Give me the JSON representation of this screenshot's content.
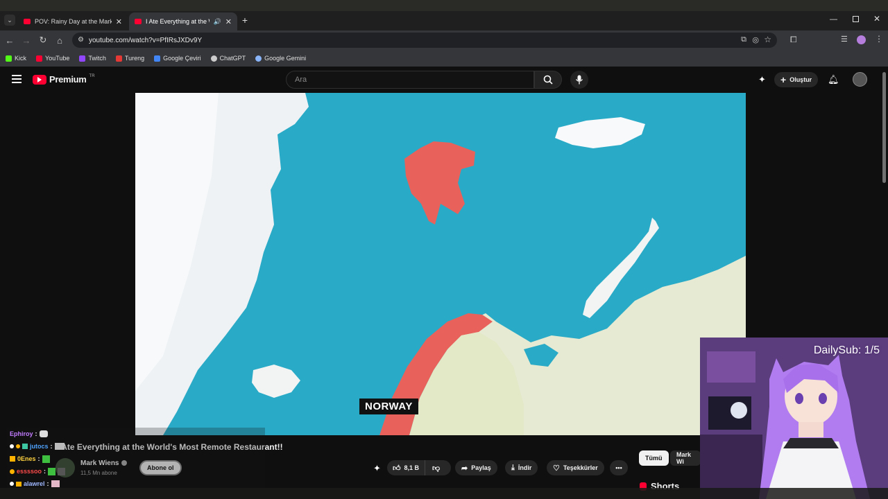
{
  "browser": {
    "tabs": [
      {
        "title": "POV: Rainy Day at the Market -",
        "active": false
      },
      {
        "title": "I Ate Everything at the Worl",
        "active": true
      }
    ],
    "url": "youtube.com/watch?v=PfIRsJXDv9Y",
    "bookmarks": [
      {
        "label": "Kick",
        "color": "#53fc18"
      },
      {
        "label": "YouTube",
        "color": "#ff0033"
      },
      {
        "label": "Twitch",
        "color": "#9146ff"
      },
      {
        "label": "Tureng",
        "color": "#e53935"
      },
      {
        "label": "Google Çeviri",
        "color": "#4285f4"
      },
      {
        "label": "ChatGPT",
        "color": "#cccccc"
      },
      {
        "label": "Google Gemini",
        "color": "#8ab4f8"
      }
    ]
  },
  "youtube": {
    "logo": "Premium",
    "region": "TR",
    "search_placeholder": "Ara",
    "create_label": "Oluştur"
  },
  "video": {
    "map_label": "NORWAY",
    "title": "I Ate Everything at the World's Most Remote Restaurant!!",
    "channel": "Mark Wiens",
    "subscribers": "11,5 Mn abone",
    "subscribe_label": "Abone ol",
    "likes": "8,1 B",
    "share_label": "Paylaş",
    "download_label": "İndir",
    "thanks_label": "Teşekkürler",
    "chips": [
      "Tümü",
      "Mark Wi"
    ],
    "shorts_label": "Shorts"
  },
  "chat": [
    {
      "user": "Ephiroy",
      "color": "#c27cff",
      "msg": ""
    },
    {
      "user": "jutocs",
      "color": "#4fa3ff",
      "msg": ""
    },
    {
      "user": "0Enes",
      "color": "#ffd23f",
      "msg": ""
    },
    {
      "user": "essssoo",
      "color": "#ff4a4a",
      "msg": ""
    },
    {
      "user": "alawrel",
      "color": "#9fb8ff",
      "msg": ""
    }
  ],
  "overlay": {
    "daily_sub": "DailySub: 1/5"
  }
}
